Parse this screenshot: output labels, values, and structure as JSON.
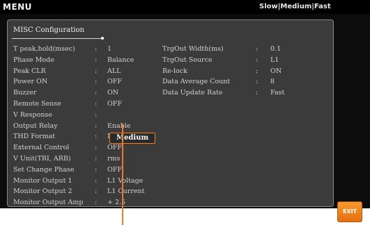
{
  "header": {
    "title": "MENU",
    "speed_options": "Slow|Medium|Fast"
  },
  "panel": {
    "title": "MISC Configuration"
  },
  "left_settings": [
    {
      "label": "T peak,hold(msec)",
      "value": "1"
    },
    {
      "label": "Phase Mode",
      "value": "Balance"
    },
    {
      "label": "Peak CLR",
      "value": "ALL"
    },
    {
      "label": "Power ON",
      "value": "OFF"
    },
    {
      "label": "Buzzer",
      "value": "ON"
    },
    {
      "label": "Remote Sense",
      "value": "OFF"
    },
    {
      "label": "V Response",
      "value": "Medium"
    },
    {
      "label": "Output Relay",
      "value": "Enable"
    },
    {
      "label": "THD Format",
      "value": "IEC"
    },
    {
      "label": "External Control",
      "value": "OFF"
    },
    {
      "label": "V Unit(TRI, ARB)",
      "value": "rms"
    },
    {
      "label": "Set Change Phase",
      "value": "OFF"
    },
    {
      "label": "Monitor Output 1",
      "value": "L1 Voltage"
    },
    {
      "label": "Monitor Output 2",
      "value": "L1 Current"
    },
    {
      "label": "Monitor Output Amp",
      "value": "+ 2.5"
    }
  ],
  "right_settings": [
    {
      "label": "TrgOut Width(ms)",
      "value": "0.1"
    },
    {
      "label": "TrgOut Source",
      "value": "L1"
    },
    {
      "label": "Re-lock",
      "value": "ON"
    },
    {
      "label": "Data Average Count",
      "value": "8"
    },
    {
      "label": "Data Update Rate",
      "value": "Fast"
    }
  ],
  "separator": ":",
  "exit_label": "EXIT"
}
